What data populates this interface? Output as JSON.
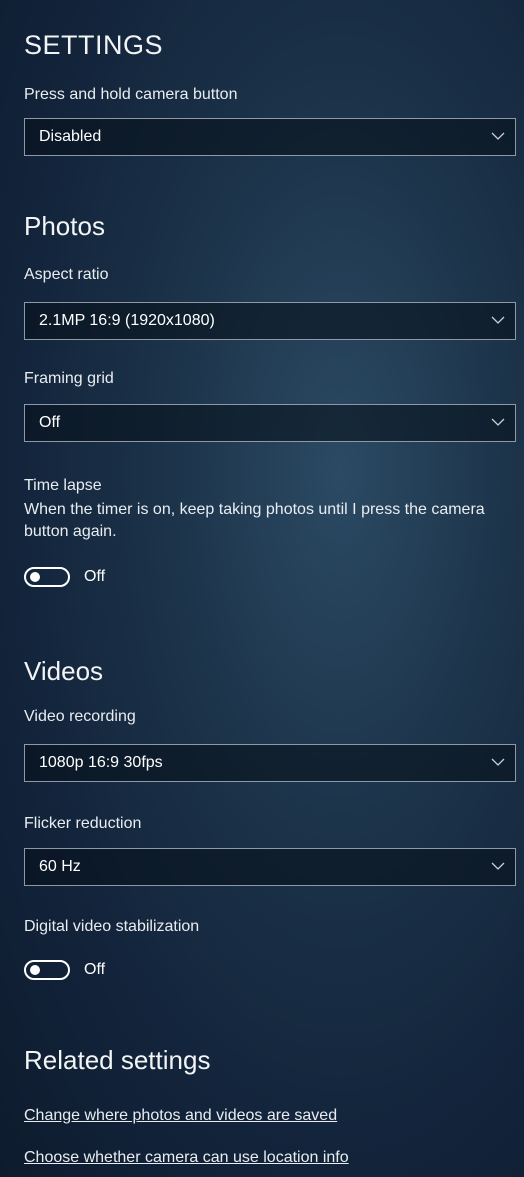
{
  "settings": {
    "title": "SETTINGS",
    "camera_button": {
      "label": "Press and hold camera button",
      "value": "Disabled"
    }
  },
  "photos": {
    "title": "Photos",
    "aspect_ratio": {
      "label": "Aspect ratio",
      "value": "2.1MP 16:9 (1920x1080)"
    },
    "framing_grid": {
      "label": "Framing grid",
      "value": "Off"
    },
    "time_lapse": {
      "label": "Time lapse",
      "description": "When the timer is on, keep taking photos until I press the camera button again.",
      "state": "Off"
    }
  },
  "videos": {
    "title": "Videos",
    "video_recording": {
      "label": "Video recording",
      "value": "1080p 16:9 30fps"
    },
    "flicker_reduction": {
      "label": "Flicker reduction",
      "value": "60 Hz"
    },
    "stabilization": {
      "label": "Digital video stabilization",
      "state": "Off"
    }
  },
  "related": {
    "title": "Related settings",
    "links": [
      "Change where photos and videos are saved",
      "Choose whether camera can use location info"
    ]
  },
  "colors": {
    "background": "#1b3248",
    "border": "#8d99a6",
    "text": "#ffffff"
  },
  "icons": {
    "dropdown": "chevron-down-icon"
  }
}
